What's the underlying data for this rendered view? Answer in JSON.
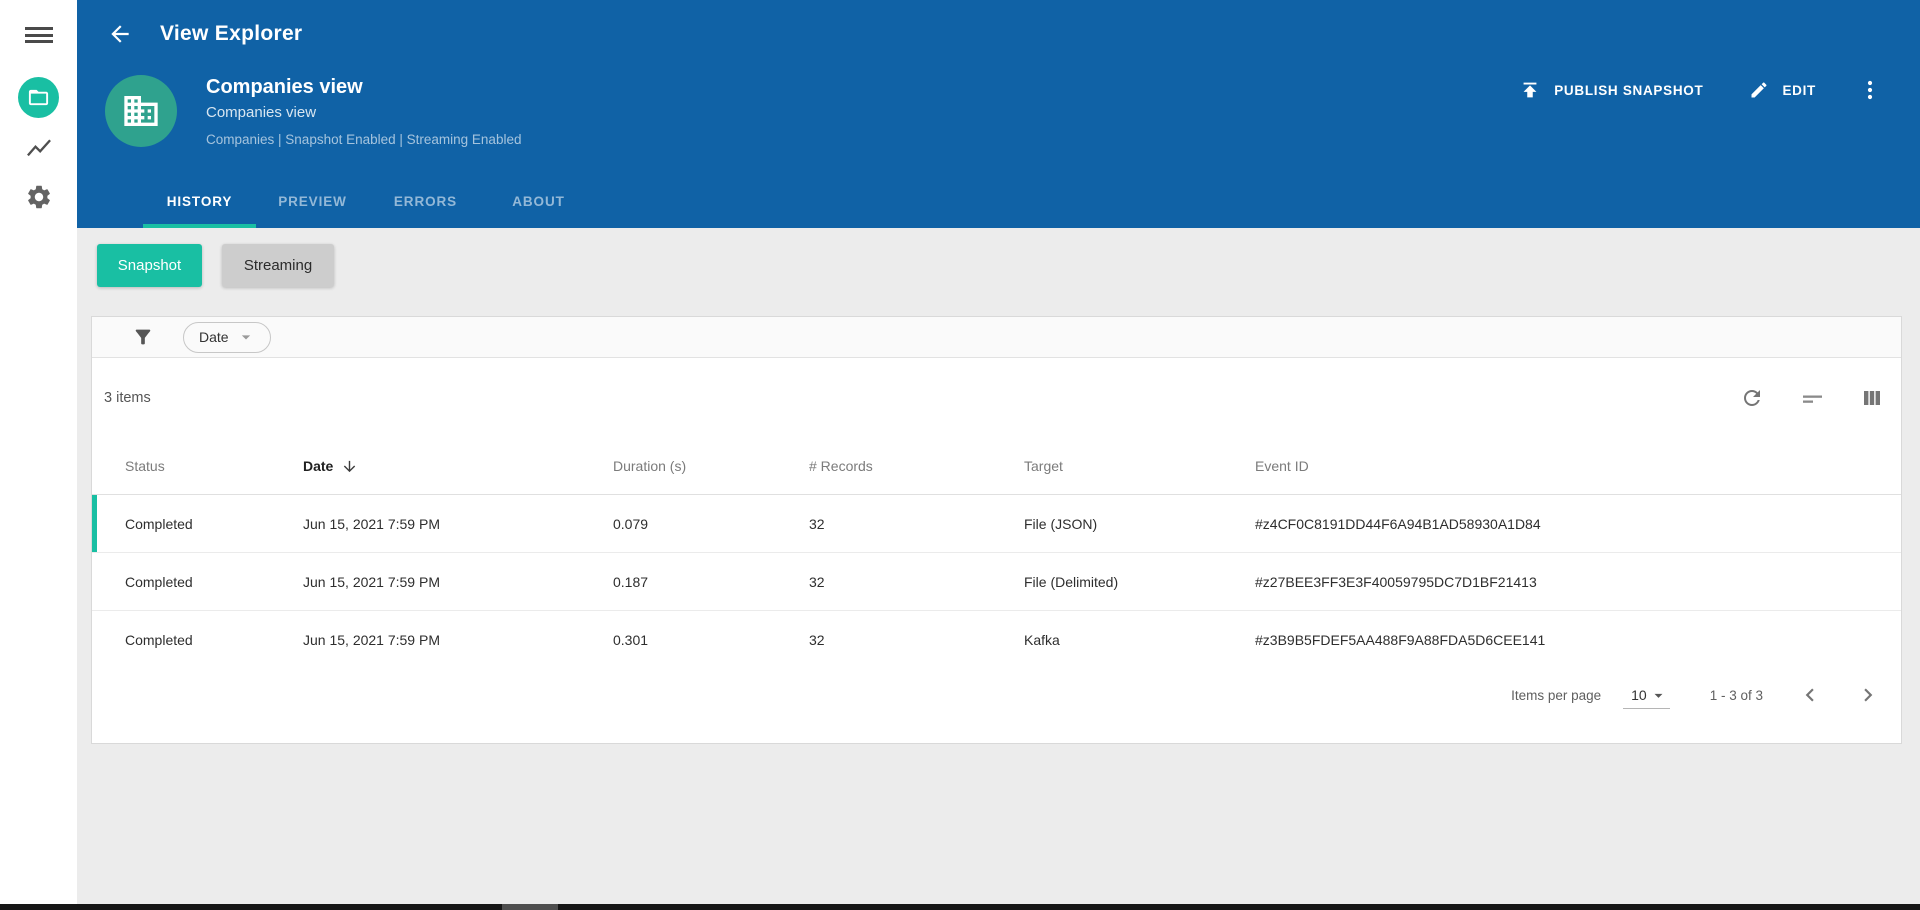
{
  "appbar": {
    "title": "View Explorer",
    "entity": {
      "title": "Companies view",
      "subtitle": "Companies view",
      "meta": "Companies | Snapshot Enabled | Streaming Enabled"
    },
    "actions": {
      "publish": "PUBLISH SNAPSHOT",
      "edit": "EDIT"
    },
    "tabs": [
      {
        "label": "HISTORY",
        "active": true
      },
      {
        "label": "PREVIEW",
        "active": false
      },
      {
        "label": "ERRORS",
        "active": false
      },
      {
        "label": "ABOUT",
        "active": false
      }
    ]
  },
  "mode_toggle": {
    "snapshot": "Snapshot",
    "streaming": "Streaming",
    "selected": "Snapshot"
  },
  "filter_bar": {
    "chip": "Date"
  },
  "table": {
    "summary": "3 items",
    "columns": [
      "Status",
      "Date",
      "Duration (s)",
      "# Records",
      "Target",
      "Event ID"
    ],
    "sorted_by": "Date",
    "sort_direction": "descending",
    "rows": [
      {
        "status": "Completed",
        "date": "Jun 15, 2021 7:59 PM",
        "duration": "0.079",
        "records": "32",
        "target": "File (JSON)",
        "event_id": "#z4CF0C8191DD44F6A94B1AD58930A1D84"
      },
      {
        "status": "Completed",
        "date": "Jun 15, 2021 7:59 PM",
        "duration": "0.187",
        "records": "32",
        "target": "File (Delimited)",
        "event_id": "#z27BEE3FF3E3F40059795DC7D1BF21413"
      },
      {
        "status": "Completed",
        "date": "Jun 15, 2021 7:59 PM",
        "duration": "0.301",
        "records": "32",
        "target": "Kafka",
        "event_id": "#z3B9B5FDEF5AA488F9A88FDA5D6CEE141"
      }
    ],
    "pagination": {
      "items_per_page_label": "Items per page",
      "page_size": "10",
      "range_label": "1 - 3 of 3"
    }
  },
  "colors": {
    "header_blue": "#1062A6",
    "accent_teal": "#19BFA3",
    "avatar_teal": "#2FA28E",
    "page_bg": "#ECECEC"
  }
}
